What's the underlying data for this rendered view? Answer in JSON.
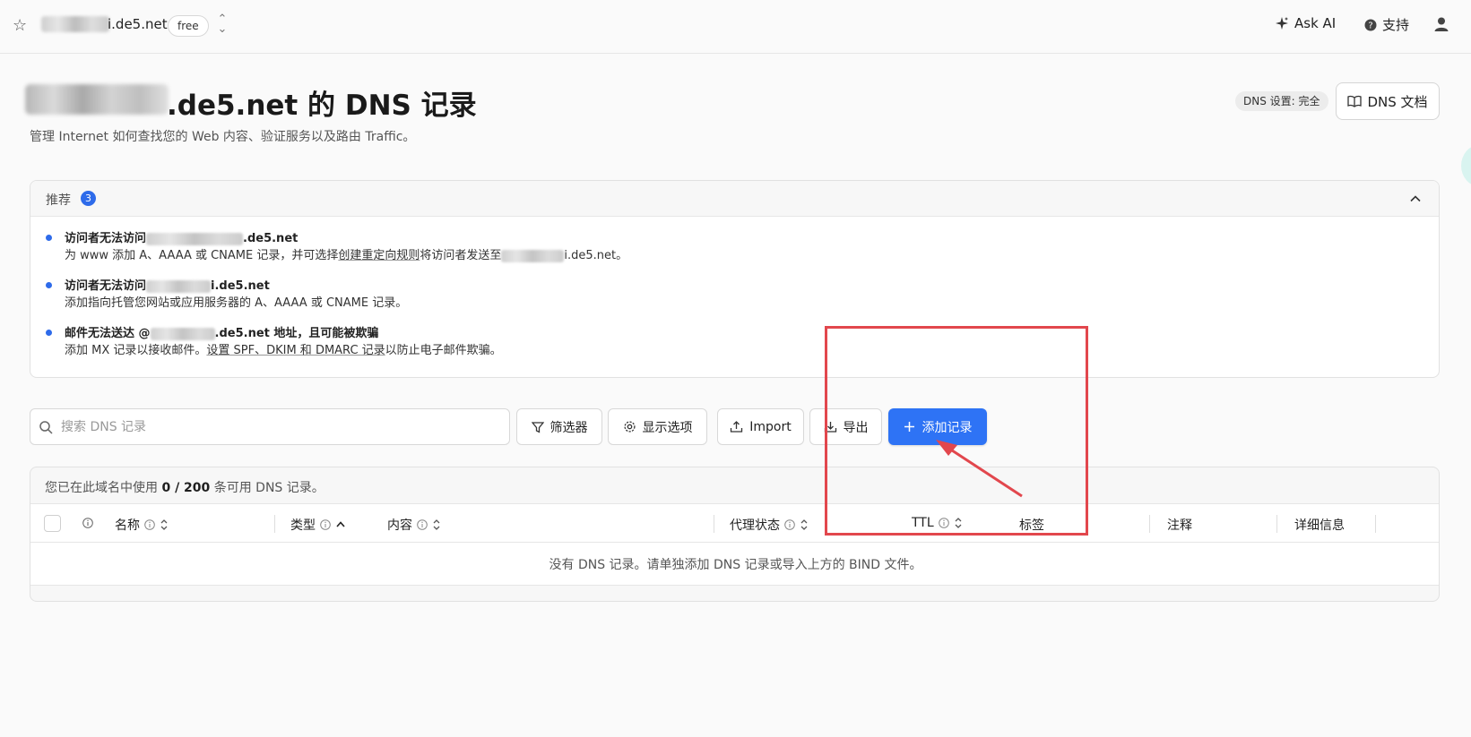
{
  "topbar": {
    "domain_suffix": "i.de5.net",
    "plan": "free",
    "ask_ai": "Ask AI",
    "support": "支持"
  },
  "header": {
    "title_suffix": ".de5.net 的 DNS 记录",
    "subtitle": "管理 Internet 如何查找您的 Web 内容、验证服务以及路由 Traffic。",
    "dns_setting": "DNS 设置: 完全",
    "docs_button": "DNS 文档"
  },
  "recommendations": {
    "label": "推荐",
    "count": "3",
    "items": [
      {
        "title_prefix": "访问者无法访问",
        "title_suffix": ".de5.net",
        "desc_a": "为 www 添加 A、AAAA 或 CNAME 记录，并可选择",
        "desc_link": "创建重定向规则",
        "desc_b": "将访问者发送至",
        "desc_suffix": "i.de5.net。"
      },
      {
        "title_prefix": "访问者无法访问",
        "title_suffix": "i.de5.net",
        "desc": "添加指向托管您网站或应用服务器的 A、AAAA 或 CNAME 记录。"
      },
      {
        "title_prefix": "邮件无法送达 @",
        "title_suffix": ".de5.net 地址，且可能被欺骗",
        "desc_a": "添加 MX 记录以接收邮件。",
        "desc_link": "设置 SPF、DKIM 和 DMARC 记录",
        "desc_b": "以防止电子邮件欺骗。"
      }
    ]
  },
  "toolbar": {
    "search_placeholder": "搜索 DNS 记录",
    "filter": "筛选器",
    "display_options": "显示选项",
    "import": "Import",
    "export": "导出",
    "add_record": "添加记录"
  },
  "records": {
    "usage_prefix": "您已在此域名中使用",
    "usage_value": "0 / 200",
    "usage_suffix": "条可用 DNS 记录。",
    "columns": {
      "name": "名称",
      "type": "类型",
      "content": "内容",
      "proxy": "代理状态",
      "ttl": "TTL",
      "tags": "标签",
      "comment": "注释",
      "details": "详细信息"
    },
    "empty_message": "没有 DNS 记录。请单独添加 DNS 记录或导入上方的 BIND 文件。"
  },
  "colors": {
    "accent": "#2e73f5",
    "annotation": "#e2474d"
  }
}
